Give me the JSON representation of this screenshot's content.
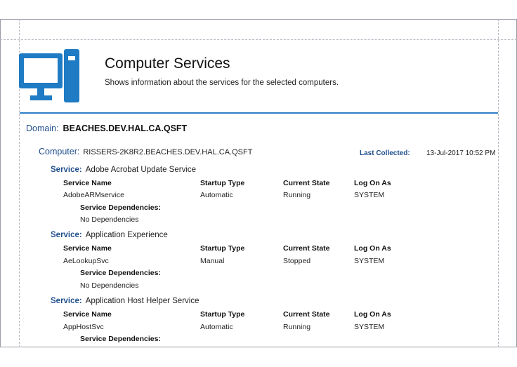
{
  "report": {
    "title": "Computer Services",
    "subtitle": "Shows information about the services for the selected computers."
  },
  "domain": {
    "label": "Domain:",
    "value": "BEACHES.DEV.HAL.CA.QSFT"
  },
  "computer": {
    "label": "Computer:",
    "value": "RISSERS-2K8R2.BEACHES.DEV.HAL.CA.QSFT",
    "last_collected_label": "Last Collected:",
    "last_collected_value": "13-Jul-2017 10:52 PM"
  },
  "columns": {
    "service_name": "Service Name",
    "startup_type": "Startup Type",
    "current_state": "Current State",
    "log_on_as": "Log On As",
    "dependencies": "Service Dependencies:"
  },
  "service_label": "Service:",
  "services": [
    {
      "display_name": "Adobe Acrobat Update Service",
      "service_name": "AdobeARMservice",
      "startup_type": "Automatic",
      "current_state": "Running",
      "log_on_as": "SYSTEM",
      "dependencies": "No Dependencies"
    },
    {
      "display_name": "Application Experience",
      "service_name": "AeLookupSvc",
      "startup_type": "Manual",
      "current_state": "Stopped",
      "log_on_as": "SYSTEM",
      "dependencies": "No Dependencies"
    },
    {
      "display_name": "Application Host Helper Service",
      "service_name": "AppHostSvc",
      "startup_type": "Automatic",
      "current_state": "Running",
      "log_on_as": "SYSTEM",
      "dependencies": ""
    }
  ],
  "colors": {
    "accent": "#2e7fc7",
    "icon": "#1e7bc4",
    "label": "#1f4e8c"
  }
}
